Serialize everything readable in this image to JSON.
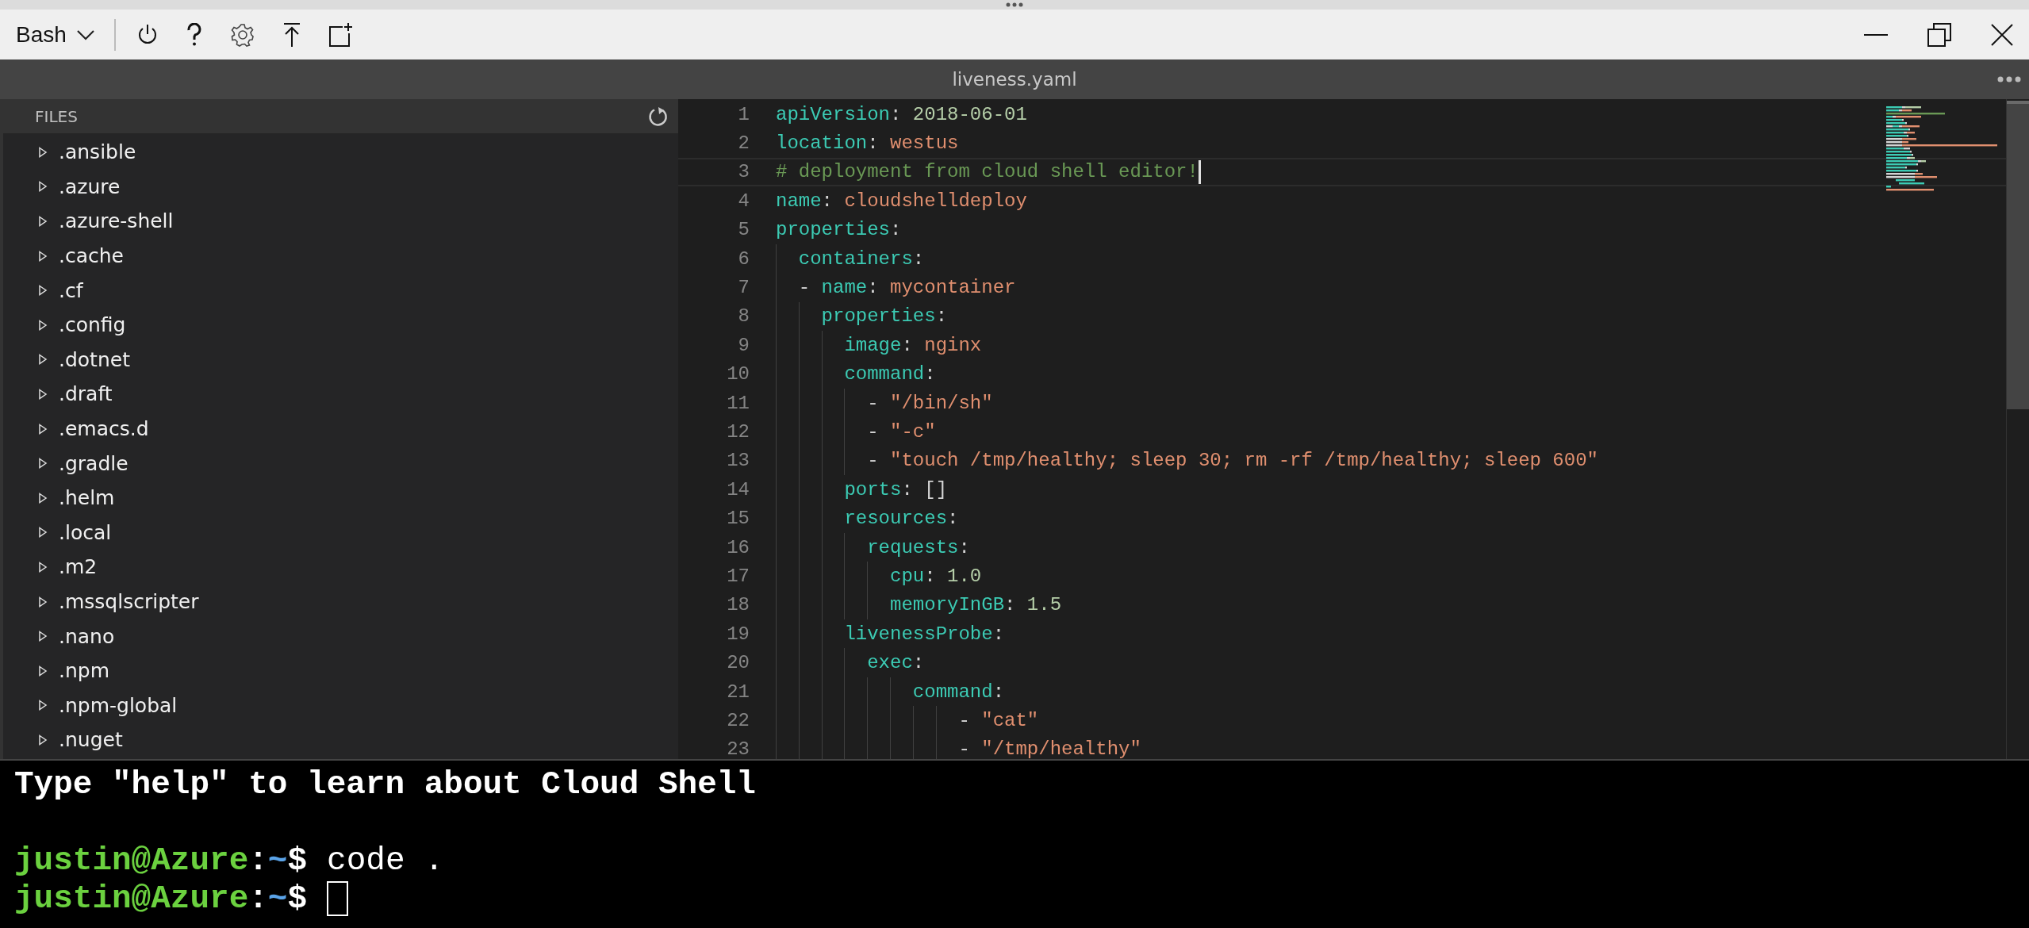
{
  "toolbar": {
    "shell": "Bash"
  },
  "editor": {
    "tab_title": "liveness.yaml",
    "files_header": "FILES",
    "files": [
      {
        "name": ".ansible",
        "expanded": false
      },
      {
        "name": ".azure",
        "expanded": false
      },
      {
        "name": ".azure-shell",
        "expanded": false
      },
      {
        "name": ".cache",
        "expanded": false
      },
      {
        "name": ".cf",
        "expanded": false
      },
      {
        "name": ".config",
        "expanded": false
      },
      {
        "name": ".dotnet",
        "expanded": false
      },
      {
        "name": ".draft",
        "expanded": false
      },
      {
        "name": ".emacs.d",
        "expanded": false
      },
      {
        "name": ".gradle",
        "expanded": false
      },
      {
        "name": ".helm",
        "expanded": false
      },
      {
        "name": ".local",
        "expanded": false
      },
      {
        "name": ".m2",
        "expanded": false
      },
      {
        "name": ".mssqlscripter",
        "expanded": false
      },
      {
        "name": ".nano",
        "expanded": false
      },
      {
        "name": ".npm",
        "expanded": false
      },
      {
        "name": ".npm-global",
        "expanded": false
      },
      {
        "name": ".nuget",
        "expanded": false
      }
    ],
    "code": [
      {
        "number": "1",
        "current": false,
        "tokens": [
          {
            "kind": "key",
            "text": "apiVersion"
          },
          {
            "kind": "punct",
            "text": ": "
          },
          {
            "kind": "number",
            "text": "2018-06-01"
          }
        ]
      },
      {
        "number": "2",
        "current": false,
        "tokens": [
          {
            "kind": "key",
            "text": "location"
          },
          {
            "kind": "punct",
            "text": ": "
          },
          {
            "kind": "string",
            "text": "westus"
          }
        ]
      },
      {
        "number": "3",
        "current": true,
        "tokens": [
          {
            "kind": "comment",
            "text": "# deployment from cloud shell editor!"
          }
        ]
      },
      {
        "number": "4",
        "current": false,
        "tokens": [
          {
            "kind": "key",
            "text": "name"
          },
          {
            "kind": "punct",
            "text": ": "
          },
          {
            "kind": "string",
            "text": "cloudshelldeploy"
          }
        ]
      },
      {
        "number": "5",
        "current": false,
        "tokens": [
          {
            "kind": "key",
            "text": "properties"
          },
          {
            "kind": "punct",
            "text": ":"
          }
        ]
      },
      {
        "number": "6",
        "current": false,
        "tokens": [
          {
            "kind": "key",
            "text": "  containers"
          },
          {
            "kind": "punct",
            "text": ":"
          }
        ]
      },
      {
        "number": "7",
        "current": false,
        "tokens": [
          {
            "kind": "punct",
            "text": "  - "
          },
          {
            "kind": "key",
            "text": "name"
          },
          {
            "kind": "punct",
            "text": ": "
          },
          {
            "kind": "string",
            "text": "mycontainer"
          }
        ]
      },
      {
        "number": "8",
        "current": false,
        "tokens": [
          {
            "kind": "key",
            "text": "    properties"
          },
          {
            "kind": "punct",
            "text": ":"
          }
        ]
      },
      {
        "number": "9",
        "current": false,
        "tokens": [
          {
            "kind": "key",
            "text": "      image"
          },
          {
            "kind": "punct",
            "text": ": "
          },
          {
            "kind": "string",
            "text": "nginx"
          }
        ]
      },
      {
        "number": "10",
        "current": false,
        "tokens": [
          {
            "kind": "key",
            "text": "      command"
          },
          {
            "kind": "punct",
            "text": ":"
          }
        ]
      },
      {
        "number": "11",
        "current": false,
        "tokens": [
          {
            "kind": "punct",
            "text": "        - "
          },
          {
            "kind": "string",
            "text": "\"/bin/sh\""
          }
        ]
      },
      {
        "number": "12",
        "current": false,
        "tokens": [
          {
            "kind": "punct",
            "text": "        - "
          },
          {
            "kind": "string",
            "text": "\"-c\""
          }
        ]
      },
      {
        "number": "13",
        "current": false,
        "tokens": [
          {
            "kind": "punct",
            "text": "        - "
          },
          {
            "kind": "string",
            "text": "\"touch /tmp/healthy; sleep 30; rm -rf /tmp/healthy; sleep 600\""
          }
        ]
      },
      {
        "number": "14",
        "current": false,
        "tokens": [
          {
            "kind": "key",
            "text": "      ports"
          },
          {
            "kind": "punct",
            "text": ": []"
          }
        ]
      },
      {
        "number": "15",
        "current": false,
        "tokens": [
          {
            "kind": "key",
            "text": "      resources"
          },
          {
            "kind": "punct",
            "text": ":"
          }
        ]
      },
      {
        "number": "16",
        "current": false,
        "tokens": [
          {
            "kind": "key",
            "text": "        requests"
          },
          {
            "kind": "punct",
            "text": ":"
          }
        ]
      },
      {
        "number": "17",
        "current": false,
        "tokens": [
          {
            "kind": "key",
            "text": "          cpu"
          },
          {
            "kind": "punct",
            "text": ": "
          },
          {
            "kind": "number",
            "text": "1.0"
          }
        ]
      },
      {
        "number": "18",
        "current": false,
        "tokens": [
          {
            "kind": "key",
            "text": "          memoryInGB"
          },
          {
            "kind": "punct",
            "text": ": "
          },
          {
            "kind": "number",
            "text": "1.5"
          }
        ]
      },
      {
        "number": "19",
        "current": false,
        "tokens": [
          {
            "kind": "key",
            "text": "      livenessProbe"
          },
          {
            "kind": "punct",
            "text": ":"
          }
        ]
      },
      {
        "number": "20",
        "current": false,
        "tokens": [
          {
            "kind": "key",
            "text": "        exec"
          },
          {
            "kind": "punct",
            "text": ":"
          }
        ]
      },
      {
        "number": "21",
        "current": false,
        "tokens": [
          {
            "kind": "key",
            "text": "            command"
          },
          {
            "kind": "punct",
            "text": ":"
          }
        ]
      },
      {
        "number": "22",
        "current": false,
        "tokens": [
          {
            "kind": "punct",
            "text": "                - "
          },
          {
            "kind": "string",
            "text": "\"cat\""
          }
        ]
      },
      {
        "number": "23",
        "current": false,
        "tokens": [
          {
            "kind": "punct",
            "text": "                - "
          },
          {
            "kind": "string",
            "text": "\"/tmp/healthy\""
          }
        ]
      }
    ]
  },
  "terminal": {
    "lines": [
      {
        "kind": "output",
        "text": "Type \"help\" to learn about Cloud Shell"
      },
      {
        "kind": "prompt",
        "user": "justin@Azure",
        "separator": ":",
        "path": "~",
        "symbol": "$",
        "command": "code .",
        "cursor": false
      },
      {
        "kind": "prompt",
        "user": "justin@Azure",
        "separator": ":",
        "path": "~",
        "symbol": "$",
        "cursor": true
      }
    ]
  }
}
